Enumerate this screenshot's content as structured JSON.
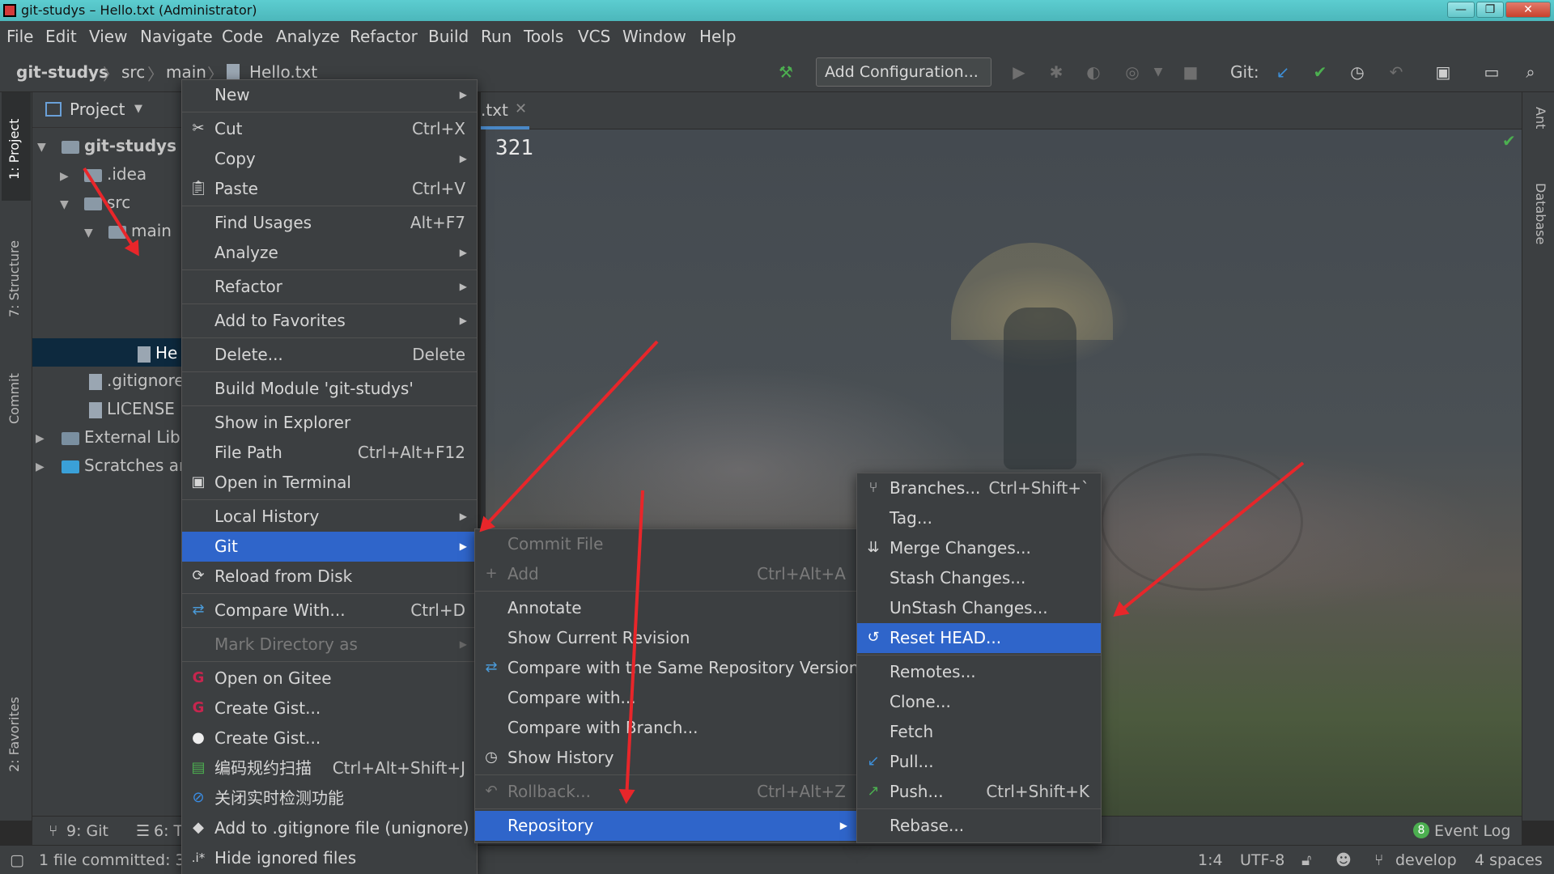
{
  "window": {
    "title": "git-studys – Hello.txt (Administrator)",
    "buttons": {
      "minimize": "—",
      "maximize": "❐",
      "close": "✕"
    }
  },
  "menubar": [
    "File",
    "Edit",
    "View",
    "Navigate",
    "Code",
    "Analyze",
    "Refactor",
    "Build",
    "Run",
    "Tools",
    "VCS",
    "Window",
    "Help"
  ],
  "navbar": {
    "breadcrumbs": [
      "git-studys",
      "src",
      "main",
      "Hello.txt"
    ],
    "add_configuration": "Add Configuration...",
    "git_label": "Git:"
  },
  "left_stripe": {
    "project": "1: Project",
    "structure": "7: Structure",
    "commit": "Commit",
    "favorites": "2: Favorites"
  },
  "right_stripe": {
    "ant": "Ant",
    "database": "Database"
  },
  "project_panel": {
    "title": "Project",
    "tree": [
      {
        "label": "git-studys",
        "bold": true
      },
      {
        "label": ".idea"
      },
      {
        "label": "src"
      },
      {
        "label": "main"
      },
      {
        "label": "He"
      },
      {
        "label": ".gitignore"
      },
      {
        "label": "LICENSE"
      },
      {
        "label": "External Libr"
      },
      {
        "label": "Scratches ar"
      }
    ]
  },
  "editor": {
    "tab_label": ".txt",
    "content": "321"
  },
  "context_menu": {
    "items": [
      {
        "label": "New",
        "arrow": true
      },
      {
        "label": "Cut",
        "shortcut": "Ctrl+X",
        "icon": "scissors-icon"
      },
      {
        "label": "Copy",
        "arrow": true
      },
      {
        "label": "Paste",
        "shortcut": "Ctrl+V",
        "icon": "clipboard-icon"
      },
      {
        "label": "Find Usages",
        "shortcut": "Alt+F7"
      },
      {
        "label": "Analyze",
        "arrow": true
      },
      {
        "label": "Refactor",
        "arrow": true
      },
      {
        "label": "Add to Favorites",
        "arrow": true
      },
      {
        "label": "Delete...",
        "shortcut": "Delete"
      },
      {
        "label": "Build Module 'git-studys'"
      },
      {
        "label": "Show in Explorer"
      },
      {
        "label": "File Path",
        "shortcut": "Ctrl+Alt+F12"
      },
      {
        "label": "Open in Terminal",
        "icon": "terminal-icon"
      },
      {
        "label": "Local History",
        "arrow": true
      },
      {
        "label": "Git",
        "arrow": true,
        "selected": true
      },
      {
        "label": "Reload from Disk",
        "icon": "reload-icon"
      },
      {
        "label": "Compare With...",
        "shortcut": "Ctrl+D",
        "icon": "compare-icon"
      },
      {
        "label": "Mark Directory as",
        "arrow": true,
        "disabled": true
      },
      {
        "label": "Open on Gitee",
        "icon": "gitee-icon"
      },
      {
        "label": "Create Gist...",
        "icon": "gitee-icon"
      },
      {
        "label": "Create Gist...",
        "icon": "github-icon"
      },
      {
        "label": "编码规约扫描",
        "shortcut": "Ctrl+Alt+Shift+J",
        "icon": "scan-icon"
      },
      {
        "label": "关闭实时检测功能",
        "icon": "disable-icon"
      },
      {
        "label": "Add to .gitignore file (unignore)",
        "icon": "gitignore-icon"
      },
      {
        "label": "Hide ignored files",
        "icon": "hide-icon"
      }
    ]
  },
  "git_menu": {
    "items": [
      {
        "label": "Commit File",
        "disabled": true
      },
      {
        "label": "Add",
        "shortcut": "Ctrl+Alt+A",
        "disabled": true,
        "icon": "plus-icon"
      },
      {
        "label": "Annotate"
      },
      {
        "label": "Show Current Revision"
      },
      {
        "label": "Compare with the Same Repository Version",
        "icon": "compare-icon"
      },
      {
        "label": "Compare with..."
      },
      {
        "label": "Compare with Branch..."
      },
      {
        "label": "Show History",
        "icon": "clock-icon"
      },
      {
        "label": "Rollback...",
        "shortcut": "Ctrl+Alt+Z",
        "disabled": true,
        "icon": "rollback-icon"
      },
      {
        "label": "Repository",
        "arrow": true,
        "selected": true
      }
    ]
  },
  "repo_menu": {
    "items": [
      {
        "label": "Branches...",
        "shortcut": "Ctrl+Shift+`",
        "icon": "branch-icon"
      },
      {
        "label": "Tag..."
      },
      {
        "label": "Merge Changes...",
        "icon": "merge-icon"
      },
      {
        "label": "Stash Changes..."
      },
      {
        "label": "UnStash Changes..."
      },
      {
        "label": "Reset HEAD...",
        "selected": true,
        "icon": "reset-icon"
      },
      {
        "label": "Remotes..."
      },
      {
        "label": "Clone..."
      },
      {
        "label": "Fetch"
      },
      {
        "label": "Pull...",
        "icon": "pull-icon"
      },
      {
        "label": "Push...",
        "shortcut": "Ctrl+Shift+K",
        "icon": "push-icon"
      },
      {
        "label": "Rebase..."
      }
    ]
  },
  "bottom_tools": {
    "git": "9: Git",
    "todo": "6: T",
    "event_log": "Event Log",
    "event_count": "8"
  },
  "status": {
    "message": "1 file committed: 3",
    "position": "1:4",
    "encoding": "UTF-8",
    "branch": "develop",
    "indent": "4 spaces"
  },
  "colors": {
    "accent": "#2f65ca",
    "annotation": "#e8262a",
    "ok_green": "#4caf50"
  }
}
